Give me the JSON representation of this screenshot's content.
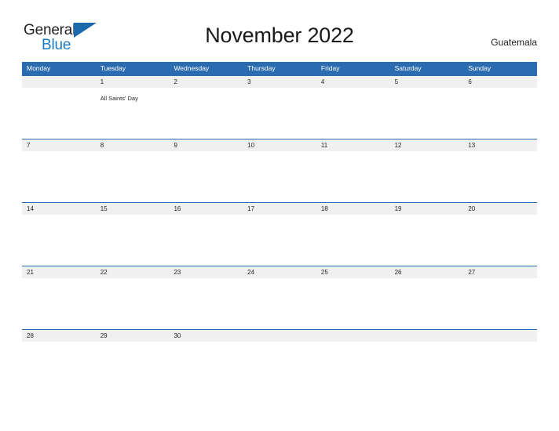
{
  "brand": {
    "name_top": "General",
    "name_bottom": "Blue",
    "flag_icon": "blue-triangle-flag-icon",
    "color_top": "#231f20",
    "color_bottom": "#1b7ac4"
  },
  "header": {
    "title": "November 2022",
    "country": "Guatemala"
  },
  "colors": {
    "header_blue": "#2b6cb0",
    "row_divider_blue": "#2b6cb0",
    "date_band_gray": "#f0f0f0",
    "text_dark": "#231f20",
    "page_background": "#ffffff"
  },
  "calendar": {
    "month": "November",
    "year": "2022",
    "weekday_headers": [
      "Monday",
      "Tuesday",
      "Wednesday",
      "Thursday",
      "Friday",
      "Saturday",
      "Sunday"
    ],
    "weeks": [
      {
        "days": [
          {
            "date": "",
            "event": ""
          },
          {
            "date": "1",
            "event": "All Saints' Day"
          },
          {
            "date": "2",
            "event": ""
          },
          {
            "date": "3",
            "event": ""
          },
          {
            "date": "4",
            "event": ""
          },
          {
            "date": "5",
            "event": ""
          },
          {
            "date": "6",
            "event": ""
          }
        ]
      },
      {
        "days": [
          {
            "date": "7",
            "event": ""
          },
          {
            "date": "8",
            "event": ""
          },
          {
            "date": "9",
            "event": ""
          },
          {
            "date": "10",
            "event": ""
          },
          {
            "date": "11",
            "event": ""
          },
          {
            "date": "12",
            "event": ""
          },
          {
            "date": "13",
            "event": ""
          }
        ]
      },
      {
        "days": [
          {
            "date": "14",
            "event": ""
          },
          {
            "date": "15",
            "event": ""
          },
          {
            "date": "16",
            "event": ""
          },
          {
            "date": "17",
            "event": ""
          },
          {
            "date": "18",
            "event": ""
          },
          {
            "date": "19",
            "event": ""
          },
          {
            "date": "20",
            "event": ""
          }
        ]
      },
      {
        "days": [
          {
            "date": "21",
            "event": ""
          },
          {
            "date": "22",
            "event": ""
          },
          {
            "date": "23",
            "event": ""
          },
          {
            "date": "24",
            "event": ""
          },
          {
            "date": "25",
            "event": ""
          },
          {
            "date": "26",
            "event": ""
          },
          {
            "date": "27",
            "event": ""
          }
        ]
      },
      {
        "days": [
          {
            "date": "28",
            "event": ""
          },
          {
            "date": "29",
            "event": ""
          },
          {
            "date": "30",
            "event": ""
          },
          {
            "date": "",
            "event": ""
          },
          {
            "date": "",
            "event": ""
          },
          {
            "date": "",
            "event": ""
          },
          {
            "date": "",
            "event": ""
          }
        ]
      }
    ]
  }
}
